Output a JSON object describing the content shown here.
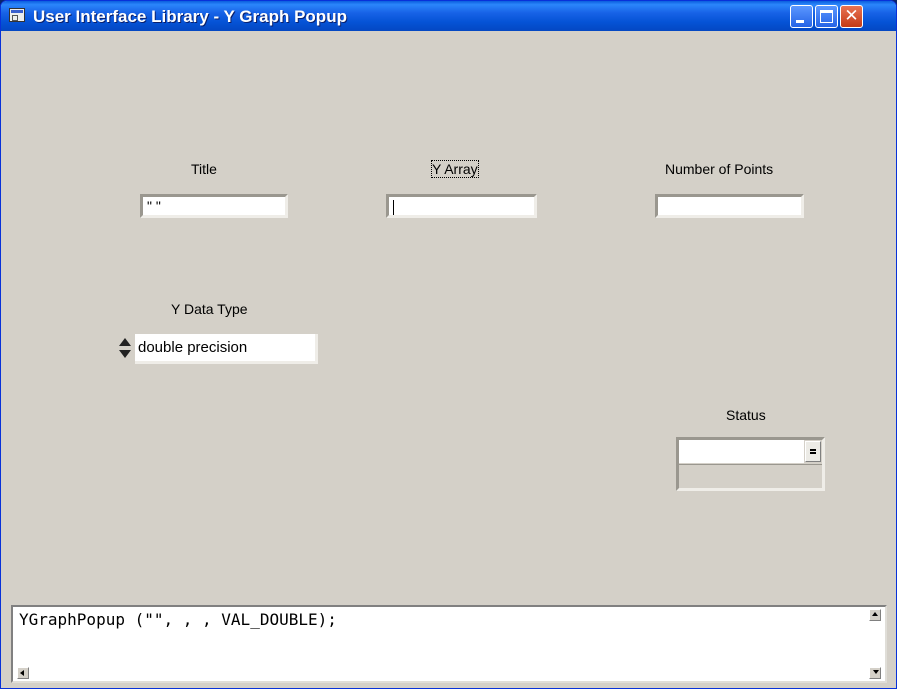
{
  "window": {
    "title": "User Interface Library - Y Graph Popup",
    "icons": {
      "app": "cvi-panel-icon",
      "minimize": "minimize-icon",
      "maximize": "maximize-icon",
      "close": "close-icon"
    },
    "close_glyph": "✕"
  },
  "controls": {
    "title": {
      "label": "Title",
      "value": "\" \""
    },
    "y_array": {
      "label": "Y Array",
      "value": ""
    },
    "number_of_points": {
      "label": "Number of Points",
      "value": ""
    },
    "y_data_type": {
      "label": "Y Data Type",
      "value": "double precision"
    },
    "status": {
      "label": "Status",
      "value": ""
    }
  },
  "function_panel": {
    "code": "YGraphPopup (\"\", , , VAL_DOUBLE);"
  },
  "colors": {
    "panel_bg": "#d4d0c8",
    "titlebar": "#0553d6",
    "close_button": "#c43a16"
  }
}
